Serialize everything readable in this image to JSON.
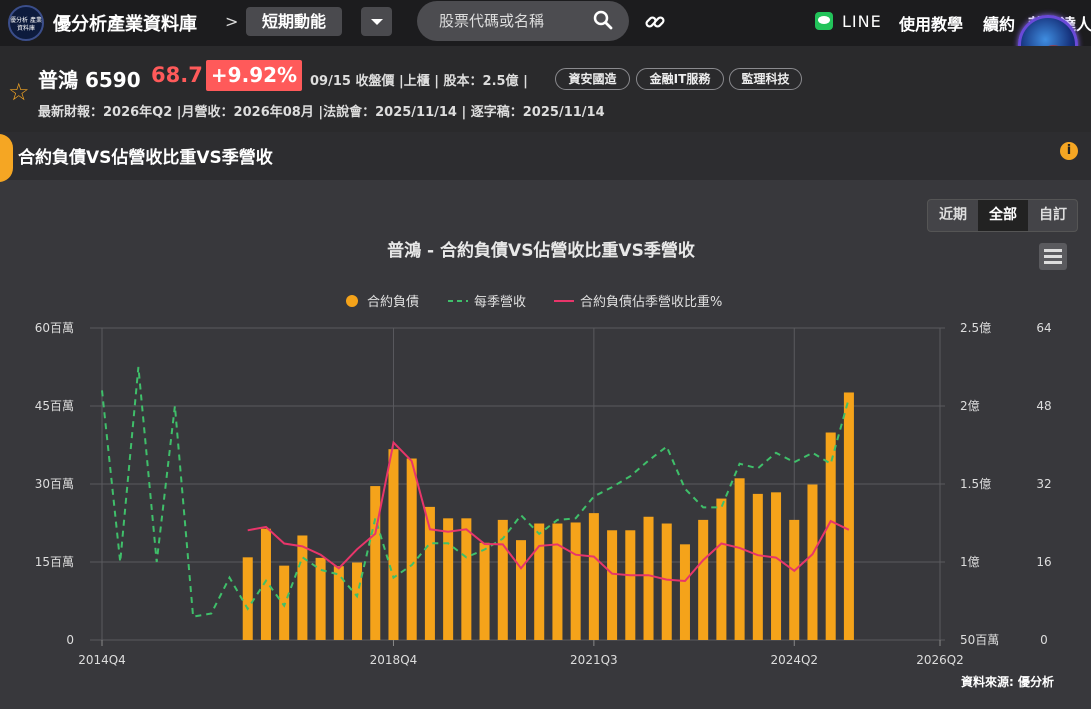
{
  "header": {
    "logo_text": "優分析 產業資料庫",
    "site_title": "優分析產業資料庫",
    "separator": ">",
    "section_button": "短期動能",
    "search_placeholder": "股票代碼或名稱",
    "line_label": "LINE",
    "nav": [
      "使用教學",
      "續約",
      "萊歌達人"
    ]
  },
  "stock": {
    "name_code": "普鴻 6590",
    "price": "68.7",
    "change": "+9.92%",
    "meta": "09/15 收盤價 |上櫃 | 股本：2.5億 |",
    "tags": [
      "資安國造",
      "金融IT服務",
      "監理科技"
    ],
    "info_line": "最新財報：2026年Q2 |月營收：2026年08月 |法說會：2025/11/14 | 逐字稿：2025/11/14"
  },
  "section": {
    "title": "合約負債VS佔營收比重VS季營收"
  },
  "range_buttons": [
    "近期",
    "全部",
    "自訂"
  ],
  "range_active": "全部",
  "source": "資料來源: 優分析",
  "colors": {
    "bar": "#f5a31a",
    "revenue_line": "#3fbf6a",
    "ratio_line": "#e8356a",
    "accent": "#f5a623",
    "up": "#ff5a5a"
  },
  "chart_data": {
    "type": "bar",
    "title": "普鴻 - 合約負債VS佔營收比重VS季營收",
    "legend_position": "top-center",
    "grid": true,
    "x_tick_labels": [
      "2014Q4",
      "2018Q4",
      "2021Q3",
      "2024Q2",
      "2026Q2"
    ],
    "x_tick_index": [
      0,
      16,
      27,
      38,
      46
    ],
    "y_left_ticks": [
      "0",
      "15百萬",
      "30百萬",
      "45百萬",
      "60百萬"
    ],
    "y_mid_ticks": [
      "50百萬",
      "1億",
      "1.5億",
      "2億",
      "2.5億"
    ],
    "y_right_ticks": [
      "0",
      "16",
      "32",
      "48",
      "64"
    ],
    "y_left_range": [
      0,
      60
    ],
    "y_mid_range": [
      0.5,
      2.5
    ],
    "y_right_range": [
      0,
      64
    ],
    "categories": [
      "2014Q4",
      "2015Q1",
      "2015Q2",
      "2015Q3",
      "2015Q4",
      "2016Q1",
      "2016Q2",
      "2016Q3",
      "2016Q4",
      "2017Q1",
      "2017Q2",
      "2017Q3",
      "2017Q4",
      "2018Q1",
      "2018Q2",
      "2018Q3",
      "2018Q4",
      "2019Q1",
      "2019Q2",
      "2019Q3",
      "2019Q4",
      "2020Q1",
      "2020Q2",
      "2020Q3",
      "2020Q4",
      "2021Q1",
      "2021Q2",
      "2021Q3",
      "2021Q4",
      "2022Q1",
      "2022Q2",
      "2022Q3",
      "2022Q4",
      "2023Q1",
      "2023Q2",
      "2023Q3",
      "2023Q4",
      "2024Q1",
      "2024Q2",
      "2024Q3",
      "2024Q4",
      "2025Q1",
      "2025Q2",
      "2025Q3",
      "2025Q4",
      "2026Q1",
      "2026Q2"
    ],
    "series": [
      {
        "name": "合約負債",
        "axis": "left",
        "unit": "百萬",
        "type": "bar",
        "values": [
          null,
          null,
          null,
          null,
          null,
          null,
          null,
          null,
          15.9,
          21.4,
          14.3,
          20.1,
          15.8,
          14.2,
          14.9,
          29.6,
          36.7,
          34.9,
          25.6,
          23.4,
          23.4,
          18.7,
          23.1,
          19.2,
          22.4,
          22.4,
          22.6,
          24.4,
          21.1,
          21.1,
          23.7,
          22.4,
          18.4,
          23.1,
          27.2,
          31.1,
          28.1,
          28.4,
          23.1,
          29.9,
          39.9,
          47.6
        ]
      },
      {
        "name": "每季營收",
        "axis": "mid",
        "unit": "億",
        "type": "line",
        "values": [
          2.1,
          1.0,
          2.25,
          1.0,
          2.0,
          0.65,
          0.67,
          0.9,
          0.7,
          0.88,
          0.72,
          1.03,
          0.95,
          0.92,
          0.78,
          1.28,
          0.9,
          0.98,
          1.12,
          1.12,
          1.03,
          1.08,
          1.15,
          1.3,
          1.18,
          1.27,
          1.28,
          1.42,
          1.48,
          1.55,
          1.65,
          1.74,
          1.47,
          1.35,
          1.35,
          1.63,
          1.6,
          1.7,
          1.64,
          1.7,
          1.63,
          2.05
        ]
      },
      {
        "name": "合約負債佔季營收比重%",
        "axis": "right",
        "unit": "%",
        "type": "line",
        "values": [
          null,
          null,
          null,
          null,
          null,
          null,
          null,
          null,
          22.5,
          23.2,
          19.8,
          19.2,
          17.5,
          14.7,
          18.6,
          21.8,
          40.5,
          36.7,
          22.7,
          22.2,
          22.7,
          19.7,
          19.6,
          14.7,
          19.3,
          19.6,
          17.5,
          17.1,
          13.6,
          13.3,
          13.3,
          12.4,
          12.1,
          16.4,
          19.8,
          18.9,
          17.4,
          16.9,
          14.2,
          17.6,
          24.4,
          22.6
        ]
      }
    ]
  }
}
